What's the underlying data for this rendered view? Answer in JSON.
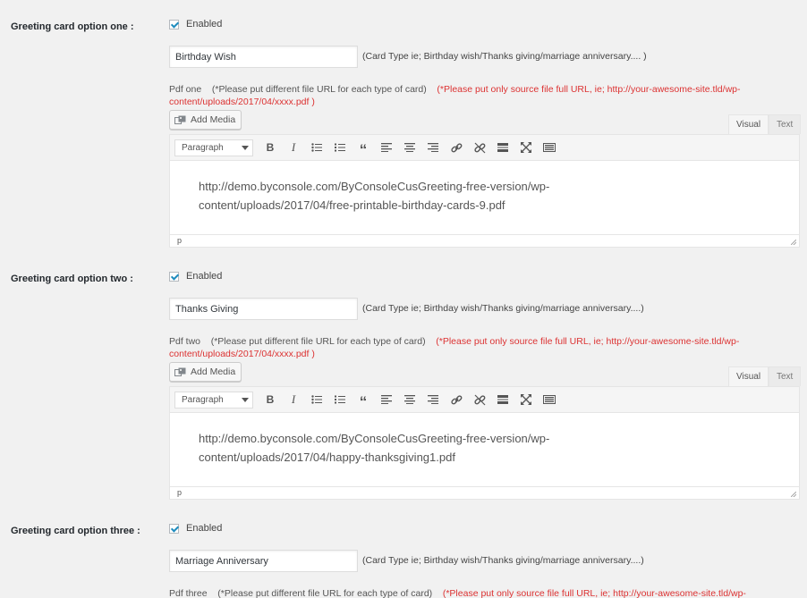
{
  "common": {
    "enabled_label": "Enabled",
    "add_media_label": "Add Media",
    "tab_visual": "Visual",
    "tab_text": "Text",
    "format_select": "Paragraph",
    "status_path": "p"
  },
  "options": [
    {
      "label": "Greeting card option one :",
      "enabled": true,
      "card_type_value": "Birthday Wish",
      "card_type_hint": "(Card Type ie; Birthday wish/Thanks giving/marriage anniversary.... )",
      "pdf_label": "Pdf one",
      "pdf_note": "(*Please put different file URL for each type of card)",
      "pdf_warning": "(*Please put only source file full URL, ie; http://your-awesome-site.tld/wp-content/uploads/2017/04/xxxx.pdf )",
      "editor_content_line1": "http://demo.byconsole.com/ByConsoleCusGreeting-free-version/wp-",
      "editor_content_line2": "content/uploads/2017/04/free-printable-birthday-cards-9.pdf"
    },
    {
      "label": "Greeting card option two :",
      "enabled": true,
      "card_type_value": "Thanks Giving",
      "card_type_hint": "(Card Type ie; Birthday wish/Thanks giving/marriage anniversary....)",
      "pdf_label": "Pdf two",
      "pdf_note": "(*Please put different file URL for each type of card)",
      "pdf_warning": "(*Please put only source file full URL, ie; http://your-awesome-site.tld/wp-content/uploads/2017/04/xxxx.pdf )",
      "editor_content_line1": "http://demo.byconsole.com/ByConsoleCusGreeting-free-version/wp-",
      "editor_content_line2": "content/uploads/2017/04/happy-thanksgiving1.pdf"
    },
    {
      "label": "Greeting card option three :",
      "enabled": true,
      "card_type_value": "Marriage Anniversary",
      "card_type_hint": "(Card Type ie; Birthday wish/Thanks giving/marriage anniversary....)",
      "pdf_label": "Pdf three",
      "pdf_note": "(*Please put different file URL for each type of card)",
      "pdf_warning": "(*Please put only source file full URL, ie; http://your-awesome-site.tld/wp-"
    }
  ]
}
